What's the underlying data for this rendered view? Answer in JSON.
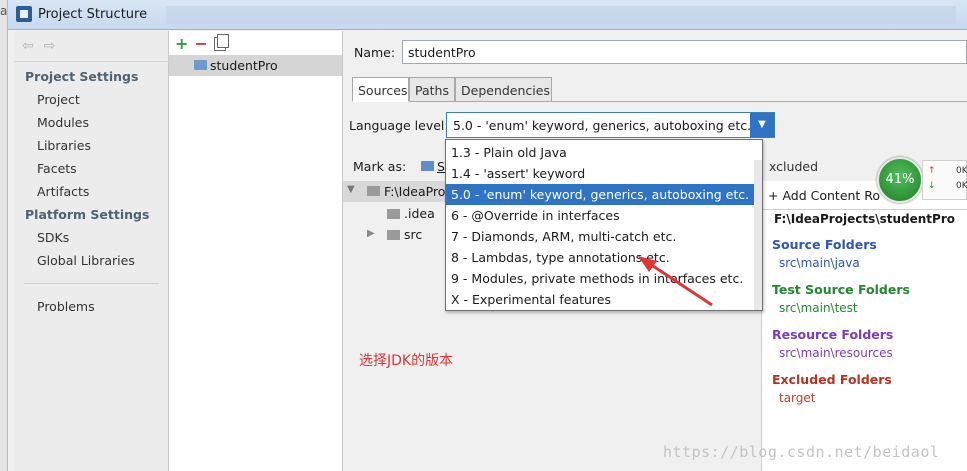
{
  "window": {
    "title": "Project Structure"
  },
  "nav": {
    "project_settings_heading": "Project Settings",
    "project_items": [
      "Project",
      "Modules",
      "Libraries",
      "Facets",
      "Artifacts"
    ],
    "platform_settings_heading": "Platform Settings",
    "platform_items": [
      "SDKs",
      "Global Libraries"
    ],
    "problems": "Problems"
  },
  "modules": {
    "toolbar": {
      "add": "+",
      "remove": "−"
    },
    "items": [
      "studentPro"
    ]
  },
  "module_settings": {
    "name_label": "Name:",
    "name_value": "studentPro",
    "tabs": [
      "Sources",
      "Paths",
      "Dependencies"
    ],
    "active_tab": "Sources",
    "language_level_label": "Language level:",
    "language_level_value": "5.0 - 'enum' keyword, generics, autoboxing etc.",
    "language_level_options": [
      "1.3 - Plain old Java",
      "1.4 - 'assert' keyword",
      "5.0 - 'enum' keyword, generics, autoboxing etc.",
      "6 - @Override in interfaces",
      "7 - Diamonds, ARM, multi-catch etc.",
      "8 - Lambdas, type annotations etc.",
      "9 - Modules, private methods in interfaces etc.",
      "X - Experimental features"
    ],
    "selected_option_index": 2,
    "mark_as_label": "Mark as:",
    "mark_as_sources": "S",
    "excluded_partial": "xcluded",
    "tree": {
      "root": "F:\\IdeaPro",
      "children": [
        ".idea",
        "src"
      ]
    },
    "annotation": "选择JDK的版本"
  },
  "content_roots": {
    "add_label": "+ Add Content Ro",
    "path": "F:\\IdeaProjects\\studentPro",
    "source_folders_title": "Source Folders",
    "source_folders_path": "src\\main\\java",
    "test_source_folders_title": "Test Source Folders",
    "test_source_folders_path": "src\\main\\test",
    "resource_folders_title": "Resource Folders",
    "resource_folders_path": "src\\main\\resources",
    "excluded_folders_title": "Excluded Folders",
    "excluded_folders_path": "target"
  },
  "speed_widget": {
    "percent": "41%",
    "upload": "0K/",
    "download": "0K/"
  },
  "watermark": "https://blog.csdn.net/beidaol",
  "colors": {
    "selection_blue": "#2f73c5",
    "source_blue": "#2b55b8",
    "test_green": "#1f8a2c",
    "resource_purple": "#7b3ac5",
    "excluded_red": "#b7331f",
    "annotation_red": "#e23434"
  }
}
